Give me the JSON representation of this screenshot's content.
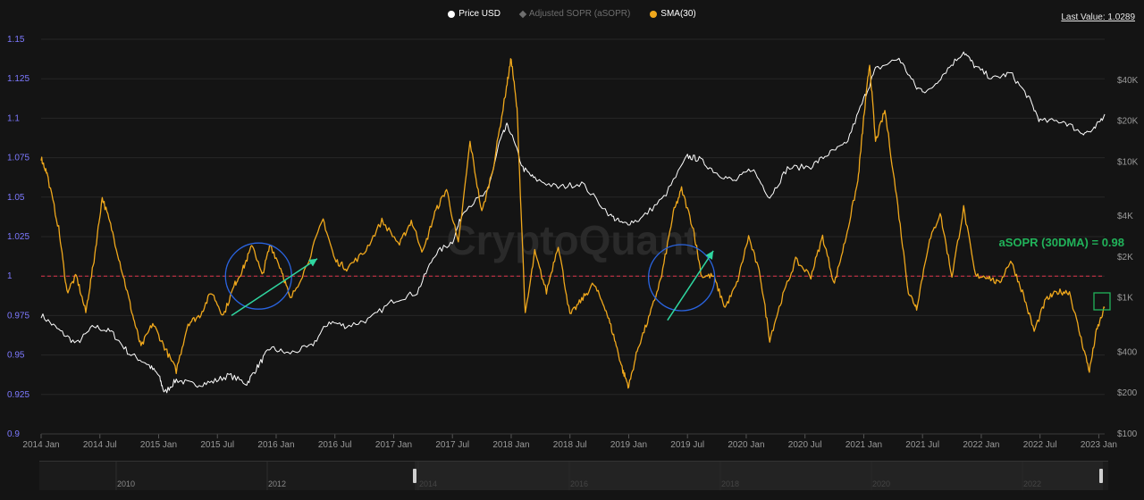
{
  "legend": {
    "price": "Price USD",
    "asopr": "Adjusted SOPR (aSOPR)",
    "sma": "SMA(30)"
  },
  "last_value": "Last Value: 1.0289",
  "watermark": "CryptoQuant",
  "annotation": "aSOPR (30DMA) = 0.98",
  "colors": {
    "price": "#ffffff",
    "asopr": "#6e6e6e",
    "sma": "#f0a81c",
    "reference": "#e0334a",
    "annotation": "#21b35a",
    "circle": "#2a64e0",
    "arrow": "#2fd6a0",
    "left_axis": "#7d79ff"
  },
  "navigator_labels": [
    "2010",
    "2012",
    "2014",
    "2016",
    "2018",
    "2020",
    "2022"
  ],
  "chart_data": {
    "type": "line",
    "title": "",
    "x_ticks": [
      "2014 Jan",
      "2014 Jul",
      "2015 Jan",
      "2015 Jul",
      "2016 Jan",
      "2016 Jul",
      "2017 Jan",
      "2017 Jul",
      "2018 Jan",
      "2018 Jul",
      "2019 Jan",
      "2019 Jul",
      "2020 Jan",
      "2020 Jul",
      "2021 Jan",
      "2021 Jul",
      "2022 Jan",
      "2022 Jul",
      "2023 Jan"
    ],
    "y_left": {
      "label": "aSOPR",
      "ticks": [
        "0.9",
        "0.925",
        "0.95",
        "0.975",
        "1",
        "1.025",
        "1.05",
        "1.075",
        "1.1",
        "1.125",
        "1.15"
      ],
      "range": [
        0.9,
        1.15
      ]
    },
    "y_right": {
      "label": "Price USD",
      "scale": "log",
      "ticks": [
        "$100",
        "$200",
        "$400",
        "$1K",
        "$2K",
        "$4K",
        "$10K",
        "$20K",
        "$40K"
      ]
    },
    "reference_line": 1,
    "series": [
      {
        "name": "Price USD",
        "axis": "right",
        "values": [
          [
            2014.0,
            750
          ],
          [
            2014.15,
            580
          ],
          [
            2014.3,
            460
          ],
          [
            2014.45,
            620
          ],
          [
            2014.6,
            560
          ],
          [
            2014.75,
            390
          ],
          [
            2014.9,
            330
          ],
          [
            2015.0,
            270
          ],
          [
            2015.05,
            200
          ],
          [
            2015.15,
            250
          ],
          [
            2015.3,
            230
          ],
          [
            2015.45,
            240
          ],
          [
            2015.6,
            270
          ],
          [
            2015.75,
            235
          ],
          [
            2015.85,
            320
          ],
          [
            2015.95,
            430
          ],
          [
            2016.1,
            390
          ],
          [
            2016.3,
            440
          ],
          [
            2016.45,
            670
          ],
          [
            2016.6,
            620
          ],
          [
            2016.8,
            700
          ],
          [
            2017.0,
            960
          ],
          [
            2017.2,
            1100
          ],
          [
            2017.35,
            2100
          ],
          [
            2017.5,
            2600
          ],
          [
            2017.6,
            4500
          ],
          [
            2017.8,
            6000
          ],
          [
            2017.9,
            14000
          ],
          [
            2017.97,
            19000
          ],
          [
            2018.1,
            9000
          ],
          [
            2018.2,
            7500
          ],
          [
            2018.4,
            6500
          ],
          [
            2018.6,
            7000
          ],
          [
            2018.85,
            4000
          ],
          [
            2018.95,
            3500
          ],
          [
            2019.1,
            3800
          ],
          [
            2019.3,
            5500
          ],
          [
            2019.5,
            11000
          ],
          [
            2019.6,
            10500
          ],
          [
            2019.75,
            8300
          ],
          [
            2019.9,
            7200
          ],
          [
            2020.05,
            9000
          ],
          [
            2020.2,
            5500
          ],
          [
            2020.35,
            9000
          ],
          [
            2020.55,
            9300
          ],
          [
            2020.7,
            11500
          ],
          [
            2020.85,
            13500
          ],
          [
            2021.0,
            29000
          ],
          [
            2021.1,
            48000
          ],
          [
            2021.3,
            58000
          ],
          [
            2021.45,
            35000
          ],
          [
            2021.55,
            33000
          ],
          [
            2021.7,
            47000
          ],
          [
            2021.85,
            65000
          ],
          [
            2021.95,
            50000
          ],
          [
            2022.1,
            41000
          ],
          [
            2022.25,
            45000
          ],
          [
            2022.4,
            30000
          ],
          [
            2022.5,
            20000
          ],
          [
            2022.7,
            20000
          ],
          [
            2022.85,
            16500
          ],
          [
            2022.95,
            16800
          ],
          [
            2023.05,
            22500
          ]
        ]
      },
      {
        "name": "SMA(30)",
        "axis": "left",
        "values": [
          [
            2014.0,
            1.075
          ],
          [
            2014.05,
            1.065
          ],
          [
            2014.15,
            1.03
          ],
          [
            2014.22,
            0.99
          ],
          [
            2014.3,
            1.0
          ],
          [
            2014.38,
            0.977
          ],
          [
            2014.45,
            1.01
          ],
          [
            2014.52,
            1.05
          ],
          [
            2014.6,
            1.03
          ],
          [
            2014.7,
            1.0
          ],
          [
            2014.78,
            0.975
          ],
          [
            2014.85,
            0.955
          ],
          [
            2014.95,
            0.97
          ],
          [
            2015.05,
            0.955
          ],
          [
            2015.15,
            0.94
          ],
          [
            2015.25,
            0.97
          ],
          [
            2015.35,
            0.975
          ],
          [
            2015.45,
            0.99
          ],
          [
            2015.55,
            0.975
          ],
          [
            2015.65,
            0.995
          ],
          [
            2015.72,
            1.005
          ],
          [
            2015.8,
            1.02
          ],
          [
            2015.88,
            1.0
          ],
          [
            2015.95,
            1.02
          ],
          [
            2016.05,
            1.003
          ],
          [
            2016.12,
            0.985
          ],
          [
            2016.25,
            1.005
          ],
          [
            2016.4,
            1.036
          ],
          [
            2016.5,
            1.01
          ],
          [
            2016.6,
            1.005
          ],
          [
            2016.75,
            1.015
          ],
          [
            2016.9,
            1.035
          ],
          [
            2017.05,
            1.02
          ],
          [
            2017.15,
            1.035
          ],
          [
            2017.25,
            1.015
          ],
          [
            2017.35,
            1.04
          ],
          [
            2017.45,
            1.055
          ],
          [
            2017.55,
            1.02
          ],
          [
            2017.65,
            1.085
          ],
          [
            2017.75,
            1.04
          ],
          [
            2017.85,
            1.07
          ],
          [
            2017.95,
            1.115
          ],
          [
            2018.0,
            1.138
          ],
          [
            2018.05,
            1.105
          ],
          [
            2018.12,
            0.975
          ],
          [
            2018.2,
            1.015
          ],
          [
            2018.3,
            0.99
          ],
          [
            2018.4,
            1.02
          ],
          [
            2018.5,
            0.975
          ],
          [
            2018.6,
            0.985
          ],
          [
            2018.7,
            0.995
          ],
          [
            2018.8,
            0.98
          ],
          [
            2018.88,
            0.96
          ],
          [
            2018.95,
            0.94
          ],
          [
            2019.0,
            0.93
          ],
          [
            2019.08,
            0.955
          ],
          [
            2019.18,
            0.975
          ],
          [
            2019.28,
            1.0
          ],
          [
            2019.38,
            1.04
          ],
          [
            2019.45,
            1.055
          ],
          [
            2019.55,
            1.03
          ],
          [
            2019.62,
            1.0
          ],
          [
            2019.72,
            1.0
          ],
          [
            2019.82,
            0.98
          ],
          [
            2019.92,
            0.995
          ],
          [
            2020.02,
            1.025
          ],
          [
            2020.12,
            1.0
          ],
          [
            2020.2,
            0.96
          ],
          [
            2020.3,
            0.985
          ],
          [
            2020.42,
            1.01
          ],
          [
            2020.55,
            1.0
          ],
          [
            2020.65,
            1.025
          ],
          [
            2020.75,
            0.995
          ],
          [
            2020.85,
            1.025
          ],
          [
            2020.95,
            1.06
          ],
          [
            2021.0,
            1.1
          ],
          [
            2021.05,
            1.135
          ],
          [
            2021.1,
            1.085
          ],
          [
            2021.18,
            1.105
          ],
          [
            2021.28,
            1.05
          ],
          [
            2021.38,
            0.99
          ],
          [
            2021.45,
            0.98
          ],
          [
            2021.55,
            1.02
          ],
          [
            2021.65,
            1.04
          ],
          [
            2021.75,
            1.0
          ],
          [
            2021.85,
            1.043
          ],
          [
            2021.95,
            1.0
          ],
          [
            2022.05,
            1.0
          ],
          [
            2022.15,
            0.995
          ],
          [
            2022.25,
            1.01
          ],
          [
            2022.35,
            0.99
          ],
          [
            2022.45,
            0.965
          ],
          [
            2022.55,
            0.985
          ],
          [
            2022.65,
            0.99
          ],
          [
            2022.75,
            0.99
          ],
          [
            2022.85,
            0.96
          ],
          [
            2022.92,
            0.94
          ],
          [
            2022.98,
            0.965
          ],
          [
            2023.05,
            0.98
          ]
        ]
      }
    ]
  }
}
